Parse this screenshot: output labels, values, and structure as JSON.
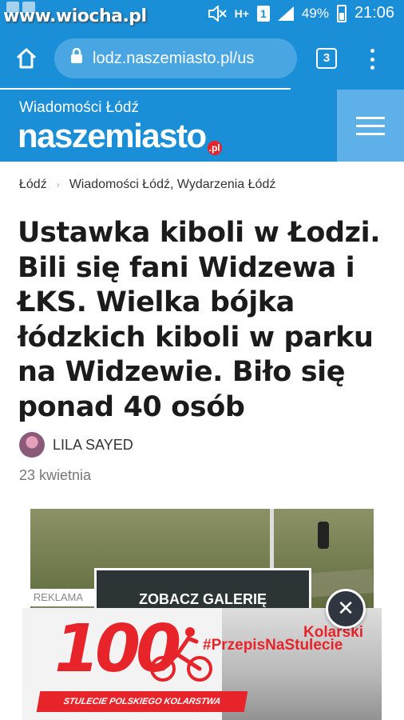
{
  "status_bar": {
    "watermark": "www.wiocha.pl",
    "network": "H+",
    "sim": "1",
    "battery": "49%",
    "time": "21:06"
  },
  "browser": {
    "url": "lodz.naszemiasto.pl/us",
    "tab_count": "3",
    "page_load_progress": 0.72
  },
  "site": {
    "kicker": "Wiadomości Łódź",
    "logo_text": "naszemiasto",
    "logo_badge": ".pl",
    "brand_color": "#1a8ed6"
  },
  "breadcrumb": {
    "items": [
      "Łódź",
      "Wiadomości Łódź, Wydarzenia Łódź"
    ]
  },
  "article": {
    "headline": "Ustawka kiboli w Łodzi. Bili się fani Widzewa i ŁKS. Wielka bójka łódzkich kiboli w parku na Widzewie. Biło się ponad 40 osób",
    "author": "LILA SAYED",
    "date": "23 kwietnia",
    "gallery_button": "ZOBACZ GALERIĘ"
  },
  "ad": {
    "label": "REKLAMA",
    "big_number": "100",
    "brand": "Kolarski",
    "hashtag": "#PrzepisNaStulecie",
    "banner": "STULECIE POLSKIEGO KOLARSTWA",
    "close_symbol": "✕",
    "accent_color": "#e8242b"
  }
}
